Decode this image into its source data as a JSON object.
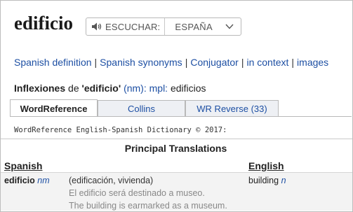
{
  "headword": "edificio",
  "audio": {
    "listen_label": "ESCUCHAR:",
    "region": "ESPAÑA"
  },
  "links": [
    {
      "label": "Spanish definition"
    },
    {
      "label": "Spanish synonyms"
    },
    {
      "label": "Conjugator"
    },
    {
      "label": "in context"
    },
    {
      "label": "images"
    }
  ],
  "links_separator": "|",
  "inflections": {
    "label": "Inflexiones",
    "connector": "de",
    "word": "'edificio'",
    "pos": "(nm):",
    "plural_label": "mpl:",
    "plural": "edificios"
  },
  "tabs": [
    {
      "label": "WordReference",
      "active": true
    },
    {
      "label": "Collins",
      "active": false
    },
    {
      "label": "WR Reverse (33)",
      "active": false
    }
  ],
  "dictionary_note": "WordReference English-Spanish Dictionary © 2017:",
  "section_title": "Principal Translations",
  "columns": {
    "source": "Spanish",
    "target": "English"
  },
  "entry": {
    "term": "edificio",
    "term_pos": "nm",
    "sense": "(edificación, vivienda)",
    "translation": "building",
    "translation_pos": "n",
    "example_es": "El edificio será destinado a museo.",
    "example_en": "The building is earmarked as a museum."
  },
  "colors": {
    "link": "#1d4fa3",
    "example": "#888888",
    "tab_inactive_bg": "#eef0f4"
  }
}
